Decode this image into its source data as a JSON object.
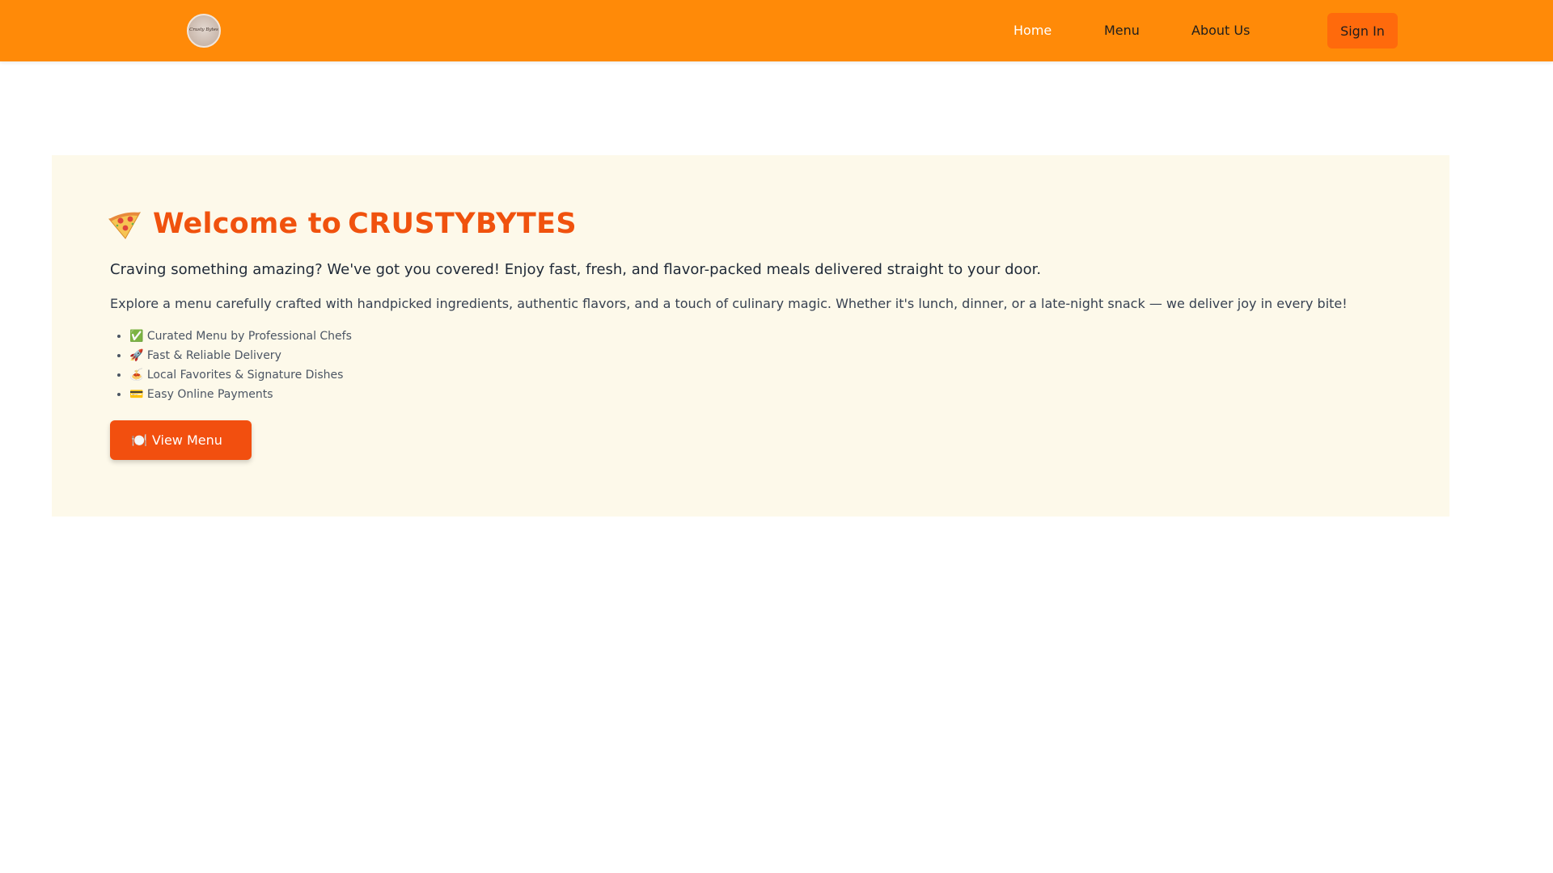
{
  "navbar": {
    "logo_text": "Crusty Bytes",
    "links": [
      {
        "label": "Home",
        "active": true
      },
      {
        "label": "Menu",
        "active": false
      },
      {
        "label": "About Us",
        "active": false
      }
    ],
    "signin_label": "Sign In",
    "colors": {
      "background": "#ff8a08",
      "active_link": "#ffffff",
      "signin_bg": "#ff6a0c"
    }
  },
  "hero": {
    "title_icon": "pizza-icon",
    "title_prefix": "Welcome to",
    "title_brand": "CRUSTYBYTES",
    "lead": "Craving something amazing? We've got you covered! Enjoy fast, fresh, and flavor-packed meals delivered straight to your door.",
    "description": "Explore a menu carefully crafted with handpicked ingredients, authentic flavors, and a touch of culinary magic. Whether it's lunch, dinner, or a late-night snack — we deliver joy in every bite!",
    "features": [
      "✅ Curated Menu by Professional Chefs",
      "🚀 Fast & Reliable Delivery",
      "🍝 Local Favorites & Signature Dishes",
      "💳 Easy Online Payments"
    ],
    "cta": {
      "icon": "🍽️",
      "label": "View Menu"
    },
    "colors": {
      "background": "#fdf9ea",
      "accent": "#f0520e",
      "cta_bg": "#f24f0f"
    }
  }
}
